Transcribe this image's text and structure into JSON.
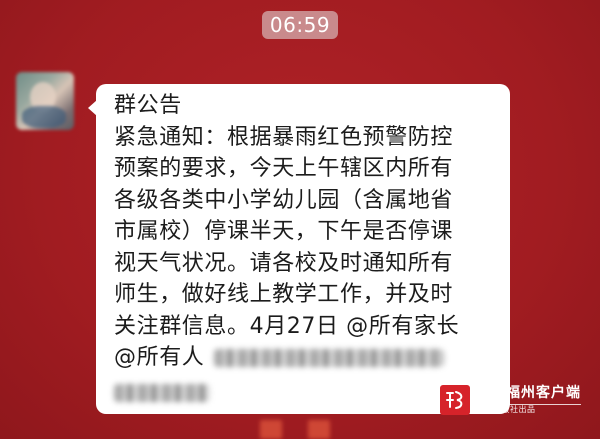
{
  "status": {
    "time": "06:59"
  },
  "message": {
    "lines": [
      "群公告",
      "紧急通知：根据暴雨红色预警防控",
      "预案的要求，今天上午辖区内所有",
      "各级各类中小学幼儿园（含属地省",
      "市属校）停课半天，下午是否停课",
      "视天气状况。请各校及时通知所有",
      "师生，做好线上教学工作，并及时",
      "关注群信息。4月27日 @所有家长"
    ],
    "mention_line": "@所有人"
  },
  "watermark": {
    "name": "掌上福州客户端",
    "sub": "福州日报社出品"
  },
  "colors": {
    "background": "#a61d22",
    "bubble": "#ffffff",
    "time_pill": "#c98a8c",
    "logo": "#d6232a"
  }
}
